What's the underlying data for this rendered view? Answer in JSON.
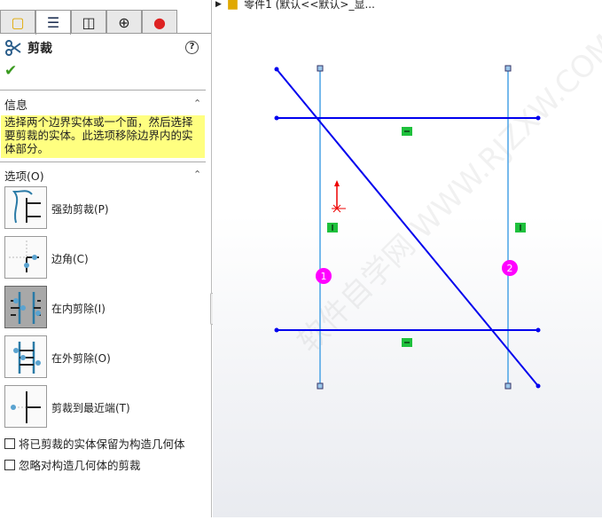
{
  "breadcrumb": {
    "text": "零件1  (默认<<默认>_显..."
  },
  "panel": {
    "tabs": [
      "feature-manager",
      "property-manager",
      "configuration-manager",
      "dimxpert",
      "display-manager"
    ],
    "title": "剪裁",
    "help": "?",
    "info_header": "信息",
    "info_text": "选择两个边界实体或一个面，然后选择要剪裁的实体。此选项移除边界内的实体部分。",
    "options_header": "选项(O)",
    "options": [
      {
        "label": "强劲剪裁(P)",
        "selected": false
      },
      {
        "label": "边角(C)",
        "selected": false
      },
      {
        "label": "在内剪除(I)",
        "selected": true
      },
      {
        "label": "在外剪除(O)",
        "selected": false
      },
      {
        "label": "剪裁到最近端(T)",
        "selected": false
      }
    ],
    "checkboxes": [
      {
        "label": "将已剪裁的实体保留为构造几何体",
        "checked": false
      },
      {
        "label": "忽略对构造几何体的剪裁",
        "checked": false
      }
    ]
  },
  "sketch": {
    "markers": [
      "1",
      "2"
    ],
    "selected_color": "#ff00ff",
    "line_color": "#0000ff",
    "boundary_color": "#4aa3e6"
  },
  "watermark": "软件自学网 WWW.RJZXW.COM"
}
